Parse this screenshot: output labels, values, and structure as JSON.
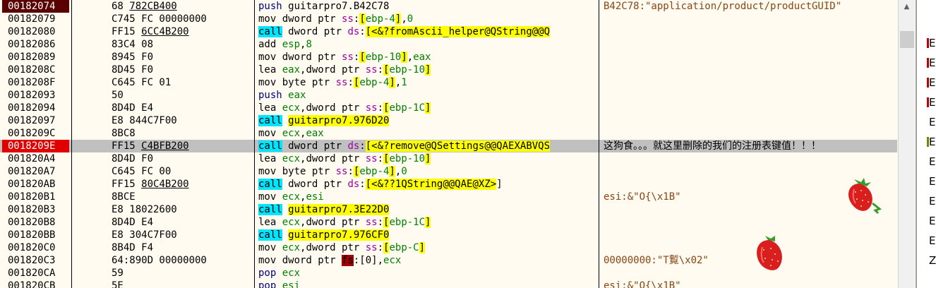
{
  "rows": [
    {
      "addr": "00182074",
      "addr_style": "bp",
      "bytes": [
        {
          "t": "68 "
        },
        {
          "t": "782CB400",
          "u": true
        }
      ],
      "asm": [
        {
          "t": "push ",
          "c": "push"
        },
        {
          "t": "guitarpro7.B42C78",
          "c": "m"
        }
      ],
      "comment": [
        {
          "t": "B42C78:\"application/product/productGUID\"",
          "c": "cstr"
        }
      ]
    },
    {
      "addr": "00182079",
      "bytes": [
        {
          "t": "C745 FC 00000000"
        }
      ],
      "asm": [
        {
          "t": "mov dword ptr ",
          "c": "m"
        },
        {
          "t": "ss",
          "c": "sym"
        },
        {
          "t": ":",
          "c": "m"
        },
        {
          "t": "[",
          "c": "br"
        },
        {
          "t": "ebp-4",
          "c": "reg"
        },
        {
          "t": "]",
          "c": "br"
        },
        {
          "t": ",",
          "c": "m"
        },
        {
          "t": "0",
          "c": "num"
        }
      ],
      "comment": []
    },
    {
      "addr": "00182080",
      "bytes": [
        {
          "t": "FF15 "
        },
        {
          "t": "6CC4B200",
          "u": true
        }
      ],
      "asm": [
        {
          "t": "call",
          "c": "call"
        },
        {
          "t": " dword ptr ",
          "c": "m"
        },
        {
          "t": "ds",
          "c": "sym"
        },
        {
          "t": ":",
          "c": "m"
        },
        {
          "t": "[",
          "c": "br"
        },
        {
          "t": "<&?fromAscii_helper@QString@@Q",
          "c": "tgt"
        }
      ],
      "comment": []
    },
    {
      "addr": "00182086",
      "bytes": [
        {
          "t": "83C4 08"
        }
      ],
      "asm": [
        {
          "t": "add ",
          "c": "m"
        },
        {
          "t": "esp",
          "c": "reg"
        },
        {
          "t": ",",
          "c": "m"
        },
        {
          "t": "8",
          "c": "num"
        }
      ],
      "comment": []
    },
    {
      "addr": "00182089",
      "bytes": [
        {
          "t": "8945 F0"
        }
      ],
      "asm": [
        {
          "t": "mov dword ptr ",
          "c": "m"
        },
        {
          "t": "ss",
          "c": "sym"
        },
        {
          "t": ":",
          "c": "m"
        },
        {
          "t": "[",
          "c": "br"
        },
        {
          "t": "ebp-10",
          "c": "reg"
        },
        {
          "t": "]",
          "c": "br"
        },
        {
          "t": ",",
          "c": "m"
        },
        {
          "t": "eax",
          "c": "reg"
        }
      ],
      "comment": []
    },
    {
      "addr": "0018208C",
      "bytes": [
        {
          "t": "8D45 F0"
        }
      ],
      "asm": [
        {
          "t": "lea ",
          "c": "m"
        },
        {
          "t": "eax",
          "c": "reg"
        },
        {
          "t": ",dword ptr ",
          "c": "m"
        },
        {
          "t": "ss",
          "c": "sym"
        },
        {
          "t": ":",
          "c": "m"
        },
        {
          "t": "[",
          "c": "br"
        },
        {
          "t": "ebp-10",
          "c": "reg"
        },
        {
          "t": "]",
          "c": "br"
        }
      ],
      "comment": []
    },
    {
      "addr": "0018208F",
      "bytes": [
        {
          "t": "C645 FC 01"
        }
      ],
      "asm": [
        {
          "t": "mov byte ptr ",
          "c": "m"
        },
        {
          "t": "ss",
          "c": "sym"
        },
        {
          "t": ":",
          "c": "m"
        },
        {
          "t": "[",
          "c": "br"
        },
        {
          "t": "ebp-4",
          "c": "reg"
        },
        {
          "t": "]",
          "c": "br"
        },
        {
          "t": ",",
          "c": "m"
        },
        {
          "t": "1",
          "c": "num"
        }
      ],
      "comment": []
    },
    {
      "addr": "00182093",
      "bytes": [
        {
          "t": "50"
        }
      ],
      "asm": [
        {
          "t": "push ",
          "c": "push"
        },
        {
          "t": "eax",
          "c": "reg"
        }
      ],
      "comment": []
    },
    {
      "addr": "00182094",
      "bytes": [
        {
          "t": "8D4D E4"
        }
      ],
      "asm": [
        {
          "t": "lea ",
          "c": "m"
        },
        {
          "t": "ecx",
          "c": "reg"
        },
        {
          "t": ",dword ptr ",
          "c": "m"
        },
        {
          "t": "ss",
          "c": "sym"
        },
        {
          "t": ":",
          "c": "m"
        },
        {
          "t": "[",
          "c": "br"
        },
        {
          "t": "ebp-1C",
          "c": "reg"
        },
        {
          "t": "]",
          "c": "br"
        }
      ],
      "comment": []
    },
    {
      "addr": "00182097",
      "bytes": [
        {
          "t": "E8 844C7F00"
        }
      ],
      "asm": [
        {
          "t": "call",
          "c": "call"
        },
        {
          "t": " ",
          "c": "m"
        },
        {
          "t": "guitarpro7.976D20",
          "c": "tgt"
        }
      ],
      "comment": []
    },
    {
      "addr": "0018209C",
      "bytes": [
        {
          "t": "8BC8"
        }
      ],
      "asm": [
        {
          "t": "mov ",
          "c": "m"
        },
        {
          "t": "ecx",
          "c": "reg"
        },
        {
          "t": ",",
          "c": "m"
        },
        {
          "t": "eax",
          "c": "reg"
        }
      ],
      "comment": []
    },
    {
      "addr": "0018209E",
      "addr_style": "bp",
      "selected": true,
      "bytes": [
        {
          "t": "FF15 "
        },
        {
          "t": "C4BFB200",
          "u": true
        }
      ],
      "asm": [
        {
          "t": "call",
          "c": "call"
        },
        {
          "t": " dword ptr ",
          "c": "m"
        },
        {
          "t": "ds",
          "c": "sym"
        },
        {
          "t": ":",
          "c": "m"
        },
        {
          "t": "[",
          "c": "br"
        },
        {
          "t": "<&?remove@QSettings@@QAEXABVQS",
          "c": "tgt"
        }
      ],
      "comment": [
        {
          "t": "这狗食。。。就这里删除的我们的注册表键值！！！",
          "c": "ccn"
        }
      ]
    },
    {
      "addr": "001820A4",
      "bytes": [
        {
          "t": "8D4D F0"
        }
      ],
      "asm": [
        {
          "t": "lea ",
          "c": "m"
        },
        {
          "t": "ecx",
          "c": "reg"
        },
        {
          "t": ",dword ptr ",
          "c": "m"
        },
        {
          "t": "ss",
          "c": "sym"
        },
        {
          "t": ":",
          "c": "m"
        },
        {
          "t": "[",
          "c": "br"
        },
        {
          "t": "ebp-10",
          "c": "reg"
        },
        {
          "t": "]",
          "c": "br"
        }
      ],
      "comment": []
    },
    {
      "addr": "001820A7",
      "bytes": [
        {
          "t": "C645 FC 00"
        }
      ],
      "asm": [
        {
          "t": "mov byte ptr ",
          "c": "m"
        },
        {
          "t": "ss",
          "c": "sym"
        },
        {
          "t": ":",
          "c": "m"
        },
        {
          "t": "[",
          "c": "br"
        },
        {
          "t": "ebp-4",
          "c": "reg"
        },
        {
          "t": "]",
          "c": "br"
        },
        {
          "t": ",",
          "c": "m"
        },
        {
          "t": "0",
          "c": "num"
        }
      ],
      "comment": []
    },
    {
      "addr": "001820AB",
      "bytes": [
        {
          "t": "FF15 "
        },
        {
          "t": "80C4B200",
          "u": true
        }
      ],
      "asm": [
        {
          "t": "call",
          "c": "call"
        },
        {
          "t": " dword ptr ",
          "c": "m"
        },
        {
          "t": "ds",
          "c": "sym"
        },
        {
          "t": ":",
          "c": "m"
        },
        {
          "t": "[",
          "c": "br"
        },
        {
          "t": "<&??1QString@@QAE@XZ>",
          "c": "tgt"
        },
        {
          "t": "]",
          "c": "m"
        }
      ],
      "comment": []
    },
    {
      "addr": "001820B1",
      "bytes": [
        {
          "t": "8BCE"
        }
      ],
      "asm": [
        {
          "t": "mov ",
          "c": "m"
        },
        {
          "t": "ecx",
          "c": "reg"
        },
        {
          "t": ",",
          "c": "m"
        },
        {
          "t": "esi",
          "c": "reg"
        }
      ],
      "comment": [
        {
          "t": "esi:&\"O{\\x1B\"",
          "c": "cstr"
        }
      ]
    },
    {
      "addr": "001820B3",
      "bytes": [
        {
          "t": "E8 18022600"
        }
      ],
      "asm": [
        {
          "t": "call",
          "c": "call"
        },
        {
          "t": " ",
          "c": "m"
        },
        {
          "t": "guitarpro7.3E22D0",
          "c": "tgt"
        }
      ],
      "comment": []
    },
    {
      "addr": "001820B8",
      "bytes": [
        {
          "t": "8D4D E4"
        }
      ],
      "asm": [
        {
          "t": "lea ",
          "c": "m"
        },
        {
          "t": "ecx",
          "c": "reg"
        },
        {
          "t": ",dword ptr ",
          "c": "m"
        },
        {
          "t": "ss",
          "c": "sym"
        },
        {
          "t": ":",
          "c": "m"
        },
        {
          "t": "[",
          "c": "br"
        },
        {
          "t": "ebp-1C",
          "c": "reg"
        },
        {
          "t": "]",
          "c": "br"
        }
      ],
      "comment": []
    },
    {
      "addr": "001820BB",
      "bytes": [
        {
          "t": "E8 304C7F00"
        }
      ],
      "asm": [
        {
          "t": "call",
          "c": "call"
        },
        {
          "t": " ",
          "c": "m"
        },
        {
          "t": "guitarpro7.976CF0",
          "c": "tgt"
        }
      ],
      "comment": []
    },
    {
      "addr": "001820C0",
      "bytes": [
        {
          "t": "8B4D F4"
        }
      ],
      "asm": [
        {
          "t": "mov ",
          "c": "m"
        },
        {
          "t": "ecx",
          "c": "reg"
        },
        {
          "t": ",dword ptr ",
          "c": "m"
        },
        {
          "t": "ss",
          "c": "sym"
        },
        {
          "t": ":",
          "c": "m"
        },
        {
          "t": "[",
          "c": "br"
        },
        {
          "t": "ebp-C",
          "c": "reg"
        },
        {
          "t": "]",
          "c": "br"
        }
      ],
      "comment": []
    },
    {
      "addr": "001820C3",
      "bytes": [
        {
          "t": "64:890D 00000000"
        }
      ],
      "asm": [
        {
          "t": "mov dword ptr ",
          "c": "m"
        },
        {
          "t": "fs",
          "c": "fs"
        },
        {
          "t": ":[0],",
          "c": "m"
        },
        {
          "t": "ecx",
          "c": "reg"
        }
      ],
      "comment": [
        {
          "t": "00000000:\"T覱\\x02\"",
          "c": "cstr"
        }
      ]
    },
    {
      "addr": "001820CA",
      "bytes": [
        {
          "t": "59"
        }
      ],
      "asm": [
        {
          "t": "pop ",
          "c": "push"
        },
        {
          "t": "ecx",
          "c": "reg"
        }
      ],
      "comment": []
    },
    {
      "addr": "001820CB",
      "bytes": [
        {
          "t": "5E"
        }
      ],
      "asm": [
        {
          "t": "pop ",
          "c": "push"
        },
        {
          "t": "esi",
          "c": "reg"
        }
      ],
      "comment": [
        {
          "t": "esi:&\"O{\\x1B\"",
          "c": "cstr"
        }
      ]
    }
  ],
  "side_letters": [
    "E",
    "E",
    "E",
    "E",
    "E",
    "E",
    "E",
    "E",
    "E",
    "E",
    "E",
    "Z"
  ],
  "side_marks": [
    "#c00000",
    "#c00000",
    "#c00000",
    "#c00000",
    "",
    "#808000",
    "",
    "",
    "",
    "",
    "",
    ""
  ],
  "colors": {
    "background": "#fffbf0",
    "breakpoint": "#e00000",
    "call_bg": "#00e5ff",
    "target_bg": "#ffff00",
    "register": "#008000",
    "segment": "#a000a0"
  },
  "icons": {
    "scroll_up": "triangle-up-icon",
    "decoration": "strawberry-icon"
  }
}
